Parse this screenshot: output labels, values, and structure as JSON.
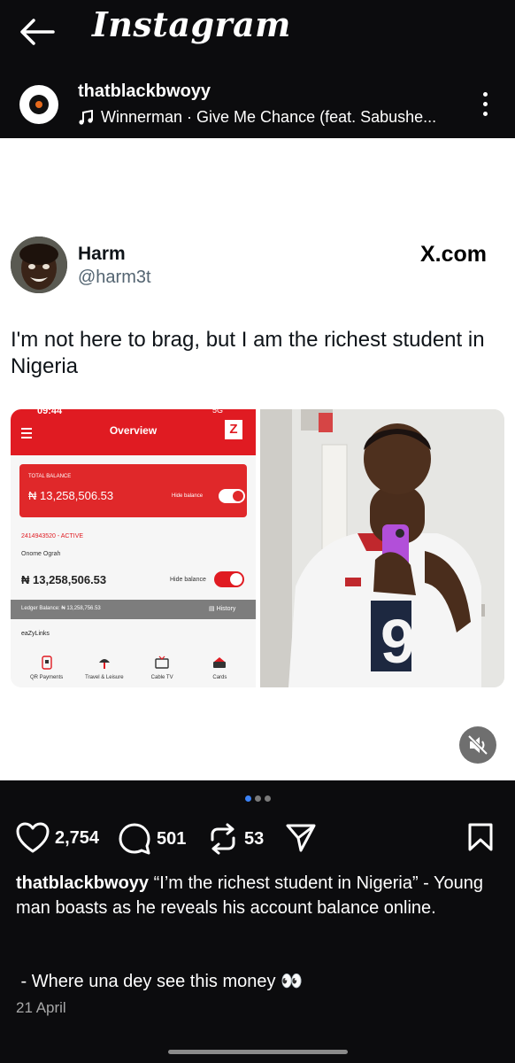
{
  "app": {
    "title": "Instagram"
  },
  "post_header": {
    "username": "thatblackbwoyy",
    "music": "Winnerman · Give Me Chance (feat. Sabushe..."
  },
  "tweet": {
    "name": "Harm",
    "handle": "@harm3t",
    "brand": "X.com",
    "text": "I'm not here to brag, but I am the richest student in Nigeria"
  },
  "bank_screenshot": {
    "status_time": "09:44",
    "status_network": "5G",
    "title": "Overview",
    "logo_letter": "Z",
    "total_balance_label": "TOTAL BALANCE",
    "total_balance": "₦ 13,258,506.53",
    "hide_balance_label": "Hide balance",
    "account_line": "2414943520 - ACTIVE",
    "account_holder": "Onome Ograh",
    "account_balance": "₦ 13,258,506.53",
    "ledger": "Ledger Balance: ₦ 13,258,756.53",
    "history_label": "History",
    "eazylinks_label": "eaZyLinks",
    "services": [
      {
        "label": "QR Payments",
        "icon": "qr-payments-icon"
      },
      {
        "label": "Travel & Leisure",
        "icon": "travel-icon"
      },
      {
        "label": "Cable TV",
        "icon": "tv-icon"
      },
      {
        "label": "Cards",
        "icon": "cards-icon"
      }
    ]
  },
  "carousel": {
    "total": 3,
    "active": 1
  },
  "actions": {
    "likes": "2,754",
    "comments": "501",
    "reposts": "53"
  },
  "caption": {
    "username": "thatblackbwoyy",
    "text": "“I’m the richest student in Nigeria” - Young man boasts as he reveals his account balance online.",
    "line2": " - Where una dey see this money 👀",
    "date": "21 April"
  },
  "colors": {
    "background": "#0c0c0e",
    "bank_red": "#e01b22",
    "carousel_active": "#3b82f6"
  }
}
